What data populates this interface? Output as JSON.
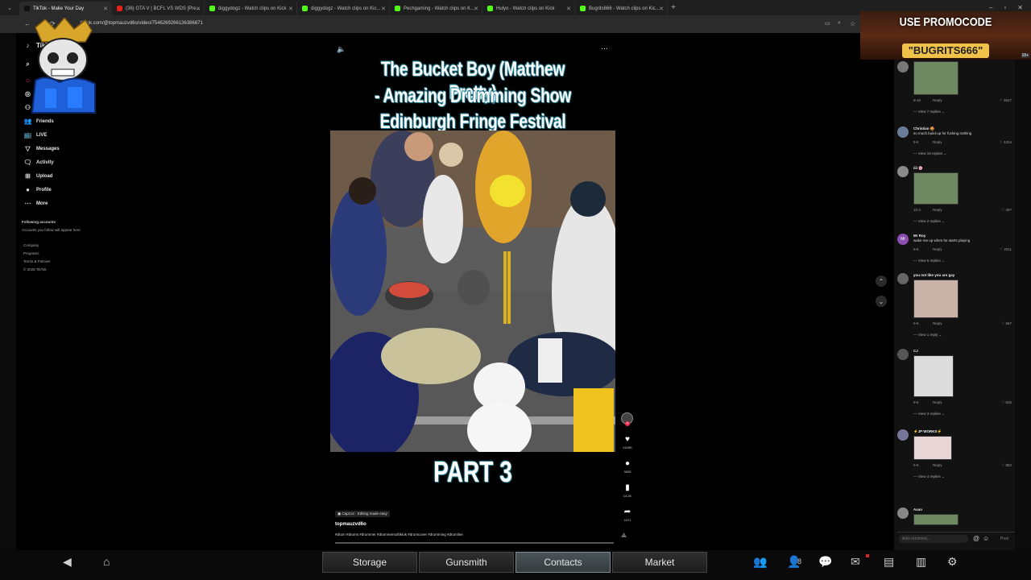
{
  "browser": {
    "tabs": [
      {
        "label": "TikTok - Make Your Day",
        "color": "#111111",
        "active": true
      },
      {
        "label": "(36) GTA V | BCFL VS WDS [Pre...",
        "color": "#e62117"
      },
      {
        "label": "diggydogz - Watch clips on Kick",
        "color": "#53fc18"
      },
      {
        "label": "diggydogz - Watch clips on Kic...",
        "color": "#53fc18"
      },
      {
        "label": "Pechgaming - Watch clips on K...",
        "color": "#53fc18"
      },
      {
        "label": "Hulyo - Watch clips on Kick",
        "color": "#53fc18"
      },
      {
        "label": "Bugrits666 - Watch clips on Kic...",
        "color": "#53fc18"
      }
    ],
    "url": "tiktok.com/@topmauzvd6o/video/7546269266136386871"
  },
  "sidebar": {
    "items": [
      {
        "label": "Friends",
        "icon": "friends-icon",
        "glyph": "👥"
      },
      {
        "label": "LIVE",
        "icon": "live-icon",
        "glyph": "📺"
      },
      {
        "label": "Messages",
        "icon": "messages-icon",
        "glyph": "▽"
      },
      {
        "label": "Activity",
        "icon": "activity-icon",
        "glyph": "🗨"
      },
      {
        "label": "Upload",
        "icon": "upload-icon",
        "glyph": "⊞"
      },
      {
        "label": "Profile",
        "icon": "profile-icon",
        "glyph": "●"
      },
      {
        "label": "More",
        "icon": "more-icon",
        "glyph": "⋯"
      }
    ],
    "following_title": "Following accounts",
    "following_desc": "Accounts you follow will appear here",
    "footer": [
      "Company",
      "Programs",
      "Terms & Policies",
      "© 2025 TikTok"
    ]
  },
  "video": {
    "title_lines": [
      "The Bucket Boy (Matthew Pretty)",
      "- Amazing Drumming Show",
      "Edinburgh Fringe Festival 2019"
    ],
    "part": "PART 3",
    "capcut": "CapCut · Editing made easy",
    "author": "topmauzvd6o",
    "hashtags": "#drum #drums #drummer #drummersoftiktok #drumcover #drumming #drumline"
  },
  "actions": [
    {
      "name": "like",
      "icon": "heart-icon",
      "glyph": "♥",
      "count": "2429K"
    },
    {
      "name": "comment",
      "icon": "comment-icon",
      "glyph": "●",
      "count": "3835"
    },
    {
      "name": "save",
      "icon": "bookmark-icon",
      "glyph": "▮",
      "count": "14.2K"
    },
    {
      "name": "share",
      "icon": "share-icon",
      "glyph": "➦",
      "count": "2471"
    }
  ],
  "comments": [
    {
      "name": "",
      "text": "",
      "meta": "9-16",
      "reply": "Reply",
      "likes": "3627",
      "replies": "View 7 replies",
      "has_thumb": true
    },
    {
      "name": "Christian 🤩",
      "text": "so much build-up for fucking nothing",
      "meta": "9-6",
      "reply": "Reply",
      "likes": "4204",
      "replies": "View 19 replies"
    },
    {
      "name": "iiii 🌸",
      "text": "",
      "meta": "10-2",
      "reply": "Reply",
      "likes": "497",
      "replies": "View 2 replies",
      "has_thumb": true
    },
    {
      "name": "Mr Roy",
      "text": "wake me up when he starts playing",
      "meta": "9-6",
      "reply": "Reply",
      "likes": "2011",
      "replies": "View 5 replies",
      "initial": "Mr"
    },
    {
      "name": "you not like you are gay",
      "text": "",
      "meta": "9-6",
      "reply": "Reply",
      "likes": "667",
      "replies": "View 1 reply",
      "has_thumb": true
    },
    {
      "name": "CJ",
      "text": "",
      "meta": "9-6",
      "reply": "Reply",
      "likes": "825",
      "replies": "View 3 replies",
      "has_thumb": true
    },
    {
      "name": "⚡JP WORKS⚡",
      "text": "",
      "meta": "9-6",
      "reply": "Reply",
      "likes": "892",
      "replies": "View 4 replies",
      "has_thumb": true
    },
    {
      "name": "Asan",
      "text": "",
      "meta": "",
      "reply": "",
      "likes": "",
      "replies": "",
      "has_thumb": true
    }
  ],
  "add_comment": {
    "placeholder": "Add comment...",
    "post": "Post"
  },
  "promo": {
    "line1": "USE PROMOCODE",
    "line2": "\"BUGRITS666\"",
    "rating": "18+"
  },
  "hud": {
    "tabs": [
      "Storage",
      "Gunsmith",
      "Contacts",
      "Market"
    ],
    "selected": "Contacts",
    "badge": "8"
  }
}
